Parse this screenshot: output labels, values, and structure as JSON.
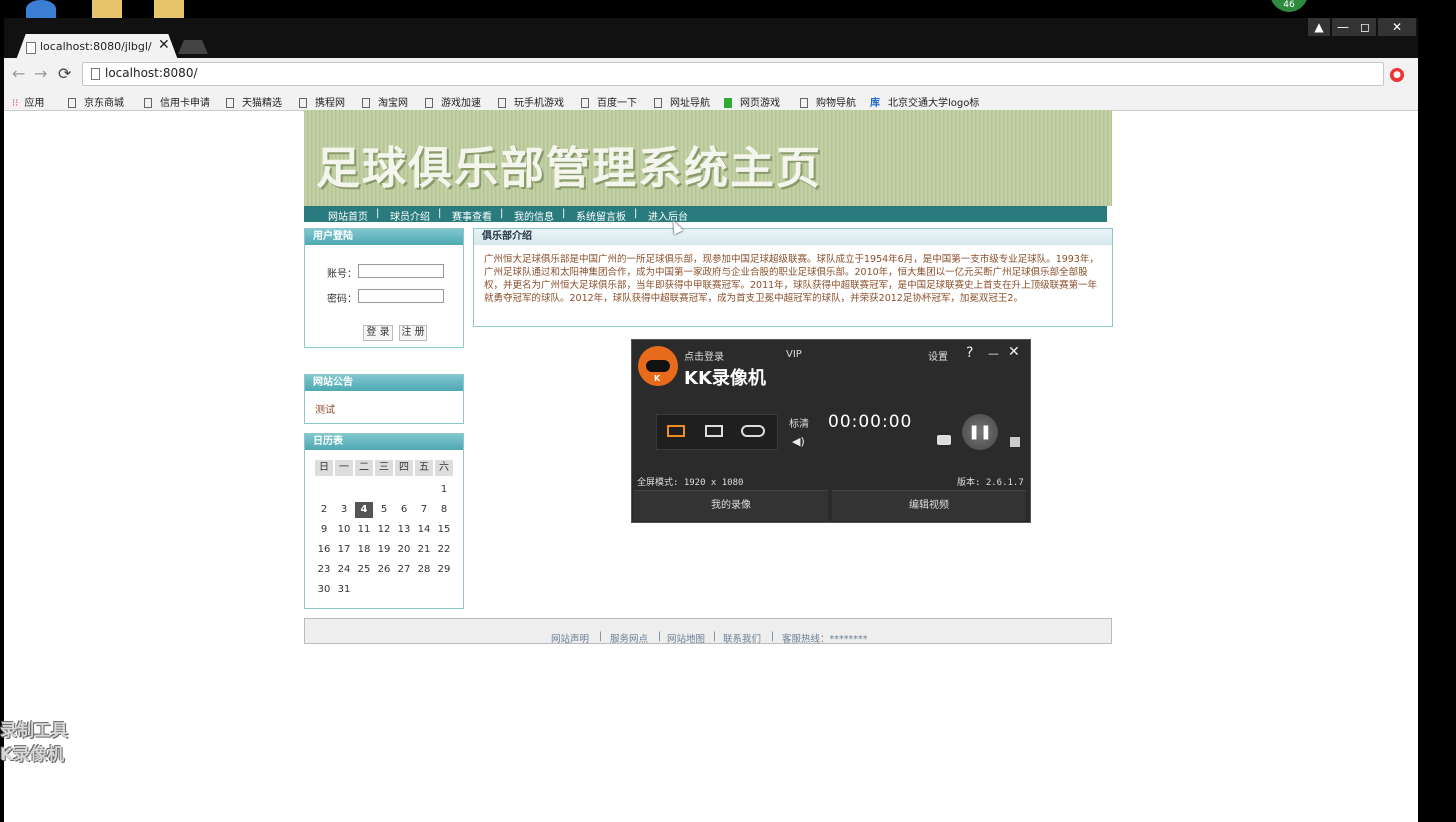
{
  "desktop": {
    "badge": "46"
  },
  "window": {
    "tab_title": "localhost:8080/jlbgl/in…",
    "tab_close": "✕",
    "controls": [
      "▲",
      "—",
      "◻",
      "✕"
    ]
  },
  "toolbar": {
    "back": "←",
    "forward": "→",
    "reload": "⟳",
    "url": "localhost:8080/"
  },
  "bookmarks": [
    "应用",
    "京东商城",
    "信用卡申请",
    "天猫精选",
    "携程网",
    "淘宝网",
    "游戏加速",
    "玩手机游戏",
    "百度一下",
    "网址导航",
    "网页游戏",
    "购物导航",
    "北京交通大学logo标"
  ],
  "site": {
    "banner_title": "足球俱乐部管理系统主页",
    "nav": [
      "网站首页",
      "球员介绍",
      "赛事查看",
      "我的信息",
      "系统留言板",
      "进入后台"
    ],
    "login": {
      "title": "用户登陆",
      "account_label": "账号：",
      "password_label": "密码：",
      "login_btn": "登 录",
      "register_btn": "注 册"
    },
    "notice": {
      "title": "网站公告",
      "item": "测试"
    },
    "calendar": {
      "title": "日历表",
      "weekdays": [
        "日",
        "一",
        "二",
        "三",
        "四",
        "五",
        "六"
      ],
      "today": "4",
      "weeks": [
        [
          "",
          "",
          "",
          "",
          "",
          "",
          "1"
        ],
        [
          "2",
          "3",
          "4",
          "5",
          "6",
          "7",
          "8"
        ],
        [
          "9",
          "10",
          "11",
          "12",
          "13",
          "14",
          "15"
        ],
        [
          "16",
          "17",
          "18",
          "19",
          "20",
          "21",
          "22"
        ],
        [
          "23",
          "24",
          "25",
          "26",
          "27",
          "28",
          "29"
        ],
        [
          "30",
          "31",
          "",
          "",
          "",
          "",
          ""
        ]
      ]
    },
    "intro": {
      "title": "俱乐部介绍",
      "text": "广州恒大足球俱乐部是中国广州的一所足球俱乐部，现参加中国足球超级联赛。球队成立于1954年6月，是中国第一支市级专业足球队。1993年，广州足球队通过和太阳神集团合作，成为中国第一家政府与企业合股的职业足球俱乐部。2010年，恒大集团以一亿元买断广州足球俱乐部全部股权，并更名为广州恒大足球俱乐部，当年即获得中甲联赛冠军。2011年，球队获得中超联赛冠军，是中国足球联赛史上首支在升上顶级联赛第一年就勇夺冠军的球队。2012年，球队获得中超联赛冠军，成为首支卫冕中超冠军的球队，并荣获2012足协杯冠军，加冕双冠王2。"
    },
    "footer": [
      "网站声明",
      "服务网点",
      "网站地图",
      "联系我们",
      "客服热线：********"
    ]
  },
  "kk": {
    "login": "点击登录",
    "vip": "VIP",
    "name": "KK录像机",
    "settings": "设置",
    "help": "?",
    "minimize": "—",
    "close": "✕",
    "quality": "标清",
    "timer": "00:00:00",
    "pause": "❚❚",
    "mode": "全屏模式: 1920 x 1080",
    "version": "版本: 2.6.1.7",
    "my_videos": "我的录像",
    "edit_video": "编辑视频"
  },
  "watermark": {
    "line1": "录制工具",
    "line2": "K录像机"
  }
}
